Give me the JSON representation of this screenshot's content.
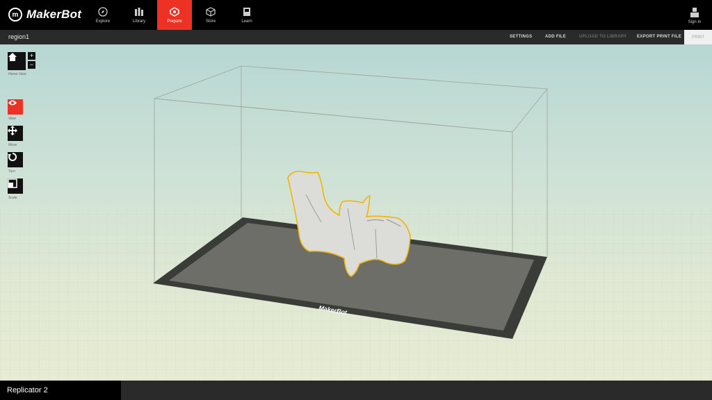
{
  "brand": {
    "name": "MakerBot"
  },
  "nav": {
    "items": [
      {
        "label": "Explore",
        "icon": "compass-icon"
      },
      {
        "label": "Library",
        "icon": "library-icon"
      },
      {
        "label": "Prepare",
        "icon": "prepare-icon",
        "active": true
      },
      {
        "label": "Store",
        "icon": "cube-icon"
      },
      {
        "label": "Learn",
        "icon": "book-icon"
      }
    ],
    "sign_in": "Sign In"
  },
  "subbar": {
    "project": "region1",
    "settings": "SETTINGS",
    "add_file": "ADD FILE",
    "upload": "UPLOAD TO LIBRARY",
    "export": "EXPORT PRINT FILE",
    "print": "PRINT"
  },
  "tools": {
    "home": "Home View",
    "zoom_in": "+",
    "zoom_out": "−",
    "view": "View",
    "move": "Move",
    "turn": "Turn",
    "scale": "Scale"
  },
  "build_plate": {
    "label": "MakerBot"
  },
  "status": {
    "printer": "Replicator 2"
  },
  "colors": {
    "accent": "#ed3124",
    "model_outline": "#f2b400",
    "plate": "#6d6e68"
  }
}
